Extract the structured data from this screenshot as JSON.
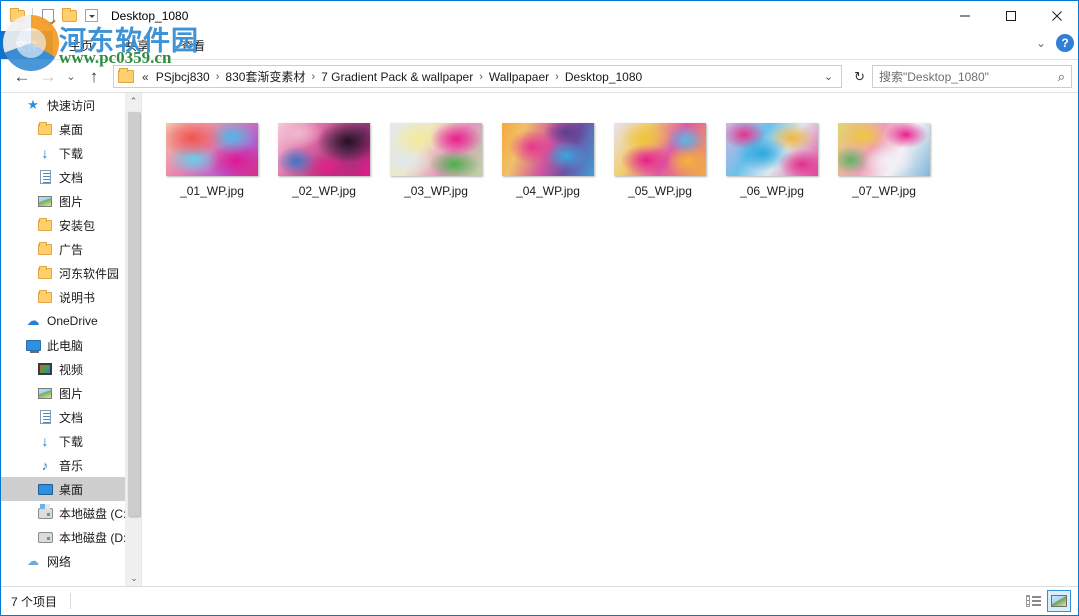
{
  "window": {
    "title": "Desktop_1080",
    "minimize_label": "—",
    "maximize_label": "□",
    "close_label": "✕"
  },
  "quick_access_toolbar": {
    "new_folder_tooltip": "新建文件夹",
    "properties_tooltip": "属性",
    "customize_label": "▾"
  },
  "ribbon": {
    "file_tab": "文件",
    "tabs": [
      {
        "label": "主页"
      },
      {
        "label": "共享"
      },
      {
        "label": "查看"
      }
    ],
    "collapse_icon": "⌄",
    "help_label": "?"
  },
  "addressbar": {
    "back_icon": "←",
    "forward_icon": "→",
    "recent_icon": "⌄",
    "up_icon": "↑",
    "overflow": "«",
    "separator": "›",
    "crumbs": [
      "PSjbcj830",
      "830套渐变素材",
      "7 Gradient Pack & wallpaper",
      "Wallpapaer",
      "Desktop_1080"
    ],
    "dropdown_icon": "⌄",
    "refresh_icon": "↻"
  },
  "search": {
    "placeholder": "搜索\"Desktop_1080\"",
    "icon": "⌕"
  },
  "sidebar": {
    "scroll_up_icon": "⌃",
    "scroll_down_icon": "⌄",
    "items": [
      {
        "label": "快速访问",
        "icon": "pinned-star-icon",
        "indent": 0,
        "pinned": false,
        "selected": false
      },
      {
        "label": "桌面",
        "icon": "folder-icon",
        "indent": 1,
        "pinned": true,
        "selected": false
      },
      {
        "label": "下载",
        "icon": "download-icon",
        "indent": 1,
        "pinned": true,
        "selected": false
      },
      {
        "label": "文档",
        "icon": "document-icon",
        "indent": 1,
        "pinned": true,
        "selected": false
      },
      {
        "label": "图片",
        "icon": "pictures-icon",
        "indent": 1,
        "pinned": true,
        "selected": false
      },
      {
        "label": "安装包",
        "icon": "folder-icon",
        "indent": 1,
        "pinned": false,
        "selected": false
      },
      {
        "label": "广告",
        "icon": "folder-icon",
        "indent": 1,
        "pinned": false,
        "selected": false
      },
      {
        "label": "河东软件园",
        "icon": "folder-icon",
        "indent": 1,
        "pinned": false,
        "selected": false
      },
      {
        "label": "说明书",
        "icon": "folder-icon",
        "indent": 1,
        "pinned": false,
        "selected": false
      },
      {
        "label": "OneDrive",
        "icon": "cloud-icon",
        "indent": 0,
        "pinned": false,
        "selected": false
      },
      {
        "label": "此电脑",
        "icon": "this-pc-icon",
        "indent": 0,
        "pinned": false,
        "selected": false
      },
      {
        "label": "视频",
        "icon": "video-icon",
        "indent": 1,
        "pinned": false,
        "selected": false
      },
      {
        "label": "图片",
        "icon": "pictures-icon",
        "indent": 1,
        "pinned": false,
        "selected": false
      },
      {
        "label": "文档",
        "icon": "document-icon",
        "indent": 1,
        "pinned": false,
        "selected": false
      },
      {
        "label": "下载",
        "icon": "download-icon",
        "indent": 1,
        "pinned": false,
        "selected": false
      },
      {
        "label": "音乐",
        "icon": "music-icon",
        "indent": 1,
        "pinned": false,
        "selected": false
      },
      {
        "label": "桌面",
        "icon": "desktop-icon",
        "indent": 1,
        "pinned": false,
        "selected": true
      },
      {
        "label": "本地磁盘 (C:)",
        "icon": "system-disk-icon",
        "indent": 1,
        "pinned": false,
        "selected": false
      },
      {
        "label": "本地磁盘 (D:)",
        "icon": "disk-icon",
        "indent": 1,
        "pinned": false,
        "selected": false
      },
      {
        "label": "网络",
        "icon": "network-icon",
        "indent": 0,
        "pinned": false,
        "selected": false
      }
    ]
  },
  "files": [
    {
      "name": "_01_WP.jpg",
      "gradient": "radial-gradient(ellipse 55% 60% at 28% 28%, #f0544f 0%, rgba(240,84,79,0) 62%), radial-gradient(ellipse 45% 55% at 72% 26%, #4fb8e8 0%, rgba(79,184,232,0) 60%), radial-gradient(ellipse 45% 50% at 30% 68%, #62d0ee 0%, rgba(98,208,238,0) 62%), radial-gradient(ellipse 50% 58% at 76% 72%, #e0188f 0%, rgba(224,24,143,0) 64%), linear-gradient(135deg, #f6c8a8 0%, #e87fae 45%, #b35bd0 75%, #d8307f 100%)"
    },
    {
      "name": "_02_WP.jpg",
      "gradient": "radial-gradient(ellipse 52% 60% at 76% 35%, #241024 0%, rgba(36,16,36,0) 66%), radial-gradient(ellipse 40% 40% at 22% 20%, #f2b8cd 0%, rgba(242,184,205,0) 70%), radial-gradient(ellipse 35% 45% at 20% 72%, #3d74c4 0%, rgba(61,116,196,0) 62%), radial-gradient(ellipse 48% 50% at 55% 85%, #e51f87 0%, rgba(229,31,135,0) 66%), linear-gradient(125deg, #f7cfdc 0%, #d8629f 40%, #8e3a77 70%, #e8198c 100%)"
    },
    {
      "name": "_03_WP.jpg",
      "gradient": "radial-gradient(ellipse 45% 50% at 72% 30%, #ea1d8c 0%, rgba(234,29,140,0) 62%), radial-gradient(ellipse 40% 45% at 30% 30%, #f2ea9e 0%, rgba(242,234,158,0) 66%), radial-gradient(ellipse 45% 45% at 70% 78%, #49b34a 0%, rgba(73,179,74,0) 62%), radial-gradient(ellipse 45% 50% at 18% 72%, #dfe7f0 0%, rgba(223,231,240,0) 66%), linear-gradient(120deg, #e4e9ee 0%, #efe8bd 35%, #e394c0 65%, #b8d8a0 100%)"
    },
    {
      "name": "_04_WP.jpg",
      "gradient": "radial-gradient(ellipse 42% 52% at 33% 45%, #e8368f 0%, rgba(232,54,143,0) 62%), radial-gradient(ellipse 40% 48% at 70% 62%, #3aa7de 0%, rgba(58,167,222,0) 60%), radial-gradient(ellipse 38% 40% at 70% 18%, #5b3d8f 0%, rgba(91,61,143,0) 66%), linear-gradient(110deg, #f5a93c 0%, #f0c06a 22%, #d2569f 50%, #6e51a5 72%, #3f9fd6 100%)"
    },
    {
      "name": "_05_WP.jpg",
      "gradient": "radial-gradient(ellipse 45% 45% at 35% 28%, #f0c33a 0%, rgba(240,195,58,0) 62%), radial-gradient(ellipse 45% 50% at 35% 70%, #e4208c 0%, rgba(228,32,140,0) 62%), radial-gradient(ellipse 35% 45% at 78% 32%, #59b6e6 0%, rgba(89,182,230,0) 62%), radial-gradient(ellipse 38% 48% at 80% 72%, #f3b33d 0%, rgba(243,179,61,0) 64%), linear-gradient(120deg, #e8e2f2 0%, #f0cd6a 30%, #e05aa6 60%, #f2ae43 100%)"
    },
    {
      "name": "_06_WP.jpg",
      "gradient": "radial-gradient(ellipse 48% 52% at 40% 58%, #2aa7e0 0%, rgba(42,167,224,0) 62%), radial-gradient(ellipse 38% 42% at 72% 28%, #f0b63c 0%, rgba(240,182,60,0) 66%), radial-gradient(ellipse 35% 42% at 20% 22%, #e4338e 0%, rgba(228,51,142,0) 66%), radial-gradient(ellipse 40% 45% at 82% 78%, #e0308c 0%, rgba(224,48,140,0) 64%), linear-gradient(125deg, #d8b4e0 0%, #6cc0e8 35%, #dde8ef 60%, #e6479a 100%)"
    },
    {
      "name": "_07_WP.jpg",
      "gradient": "radial-gradient(ellipse 40% 45% at 28% 25%, #f2c63c 0%, rgba(242,198,60,0) 64%), radial-gradient(ellipse 38% 42% at 74% 22%, #e61f8e 0%, rgba(230,31,142,0) 62%), radial-gradient(ellipse 45% 45% at 55% 72%, #f2f0f5 0%, rgba(242,240,245,0) 64%), radial-gradient(ellipse 32% 42% at 14% 70%, #62b06a 0%, rgba(98,176,106,0) 64%), linear-gradient(120deg, #e0d86a 0%, #ef9fb8 40%, #f4f2f6 65%, #7fb6d8 100%)"
    }
  ],
  "statusbar": {
    "item_count": "7 个项目",
    "details_view_tooltip": "详细信息",
    "thumbnail_view_tooltip": "大图标"
  },
  "watermark": {
    "site_name": "河东软件园",
    "url": "www.pc0359.cn"
  },
  "colors": {
    "accent": "#0078d7",
    "file_tab": "#1e6fbf",
    "selection": "#cfcfcf",
    "watermark_blue": "#3d93d6",
    "watermark_green": "#2e8b3d"
  }
}
